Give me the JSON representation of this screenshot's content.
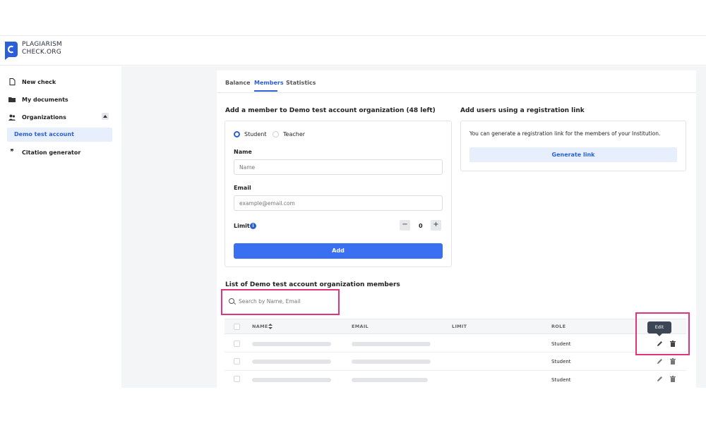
{
  "brand": {
    "line1": "PLAGIARISM",
    "line2": "CHECK.ORG",
    "color": "#2b5fd9"
  },
  "sidebar": {
    "items": [
      {
        "label": "New check",
        "icon": "document-icon"
      },
      {
        "label": "My documents",
        "icon": "folder-icon"
      },
      {
        "label": "Organizations",
        "icon": "people-icon"
      },
      {
        "label": "Demo test account",
        "icon": ""
      },
      {
        "label": "Citation generator",
        "icon": "quote-icon"
      }
    ]
  },
  "tabs": [
    {
      "label": "Balance"
    },
    {
      "label": "Members",
      "active": true
    },
    {
      "label": "Statistics"
    }
  ],
  "add_member": {
    "title": "Add a member to Demo test account organization (48 left)",
    "role_options": [
      "Student",
      "Teacher"
    ],
    "selected_role": "Student",
    "name_label": "Name",
    "name_placeholder": "Name",
    "email_label": "Email",
    "email_placeholder": "example@email.com",
    "limit_label": "Limit",
    "limit_value": "0",
    "add_button": "Add"
  },
  "registration": {
    "title": "Add users using a registration link",
    "description": "You can generate a registration link for the members of your Institution.",
    "button": "Generate link"
  },
  "members": {
    "title": "List of Demo test account organization members",
    "search_placeholder": "Search by Name, Email",
    "columns": [
      "NAME",
      "EMAIL",
      "LIMIT",
      "ROLE"
    ],
    "rows": [
      {
        "role": "Student"
      },
      {
        "role": "Student"
      },
      {
        "role": "Student"
      }
    ],
    "tooltip": "Edit"
  },
  "colors": {
    "accent": "#2b5fd9",
    "primary_button": "#3a6ff2",
    "highlight": "#e0357a"
  }
}
